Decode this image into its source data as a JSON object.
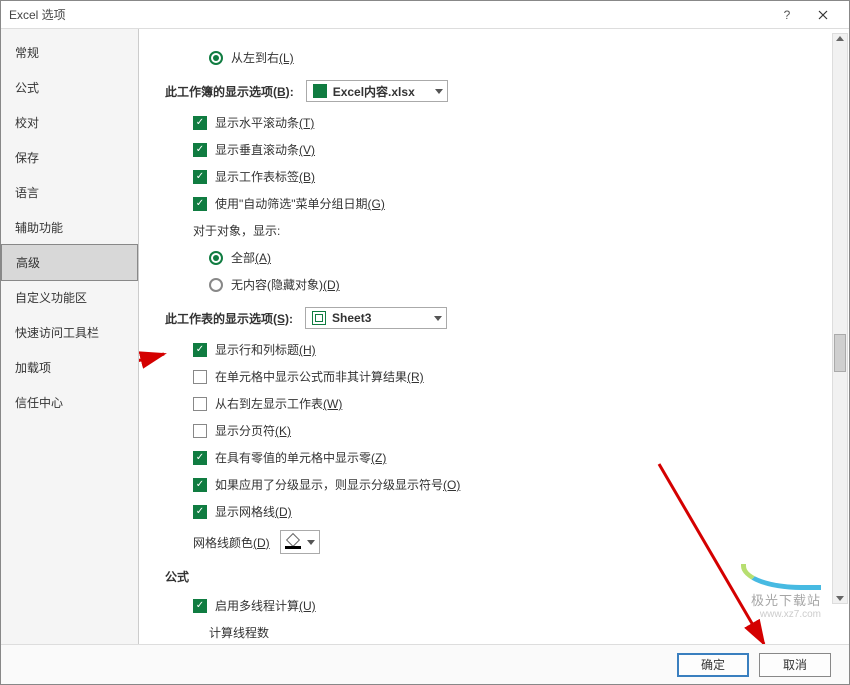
{
  "dialog": {
    "title": "Excel 选项"
  },
  "sidebar": {
    "items": [
      {
        "label": "常规"
      },
      {
        "label": "公式"
      },
      {
        "label": "校对"
      },
      {
        "label": "保存"
      },
      {
        "label": "语言"
      },
      {
        "label": "辅助功能"
      },
      {
        "label": "高级"
      },
      {
        "label": "自定义功能区"
      },
      {
        "label": "快速访问工具栏"
      },
      {
        "label": "加载项"
      },
      {
        "label": "信任中心"
      }
    ],
    "selected_index": 6
  },
  "top_option": {
    "ltr_label": "从左到右",
    "ltr_accel": "(L)"
  },
  "workbook_section": {
    "heading_prefix": "此工作簿的显示选项",
    "heading_accel": "(B)",
    "dropdown_value": "Excel内容.xlsx",
    "opt_hscroll": "显示水平滚动条",
    "opt_hscroll_accel": "(T)",
    "opt_vscroll": "显示垂直滚动条",
    "opt_vscroll_accel": "(V)",
    "opt_tabs": "显示工作表标签",
    "opt_tabs_accel": "(B)",
    "opt_autofilter": "使用\"自动筛选\"菜单分组日期",
    "opt_autofilter_accel": "(G)",
    "objects_label": "对于对象，显示:",
    "radio_all": "全部",
    "radio_all_accel": "(A)",
    "radio_none": "无内容(隐藏对象)",
    "radio_none_accel": "(D)"
  },
  "worksheet_section": {
    "heading_prefix": "此工作表的显示选项",
    "heading_accel": "(S)",
    "dropdown_value": "Sheet3",
    "opt_headings": "显示行和列标题",
    "opt_headings_accel": "(H)",
    "opt_formulas": "在单元格中显示公式而非其计算结果",
    "opt_formulas_accel": "(R)",
    "opt_rtl": "从右到左显示工作表",
    "opt_rtl_accel": "(W)",
    "opt_pagebreaks": "显示分页符",
    "opt_pagebreaks_accel": "(K)",
    "opt_zeros": "在具有零值的单元格中显示零",
    "opt_zeros_accel": "(Z)",
    "opt_outline": "如果应用了分级显示，则显示分级显示符号",
    "opt_outline_accel": "(O)",
    "opt_gridlines": "显示网格线",
    "opt_gridlines_accel": "(D)",
    "gridline_color_label": "网格线颜色",
    "gridline_color_accel": "(D)"
  },
  "formula_section": {
    "heading": "公式",
    "opt_multithread": "启用多线程计算",
    "opt_multithread_accel": "(U)",
    "threads_label": "计算线程数"
  },
  "footer": {
    "ok": "确定",
    "cancel": "取消"
  },
  "watermark": {
    "name": "极光下载站",
    "url": "www.xz7.com"
  }
}
